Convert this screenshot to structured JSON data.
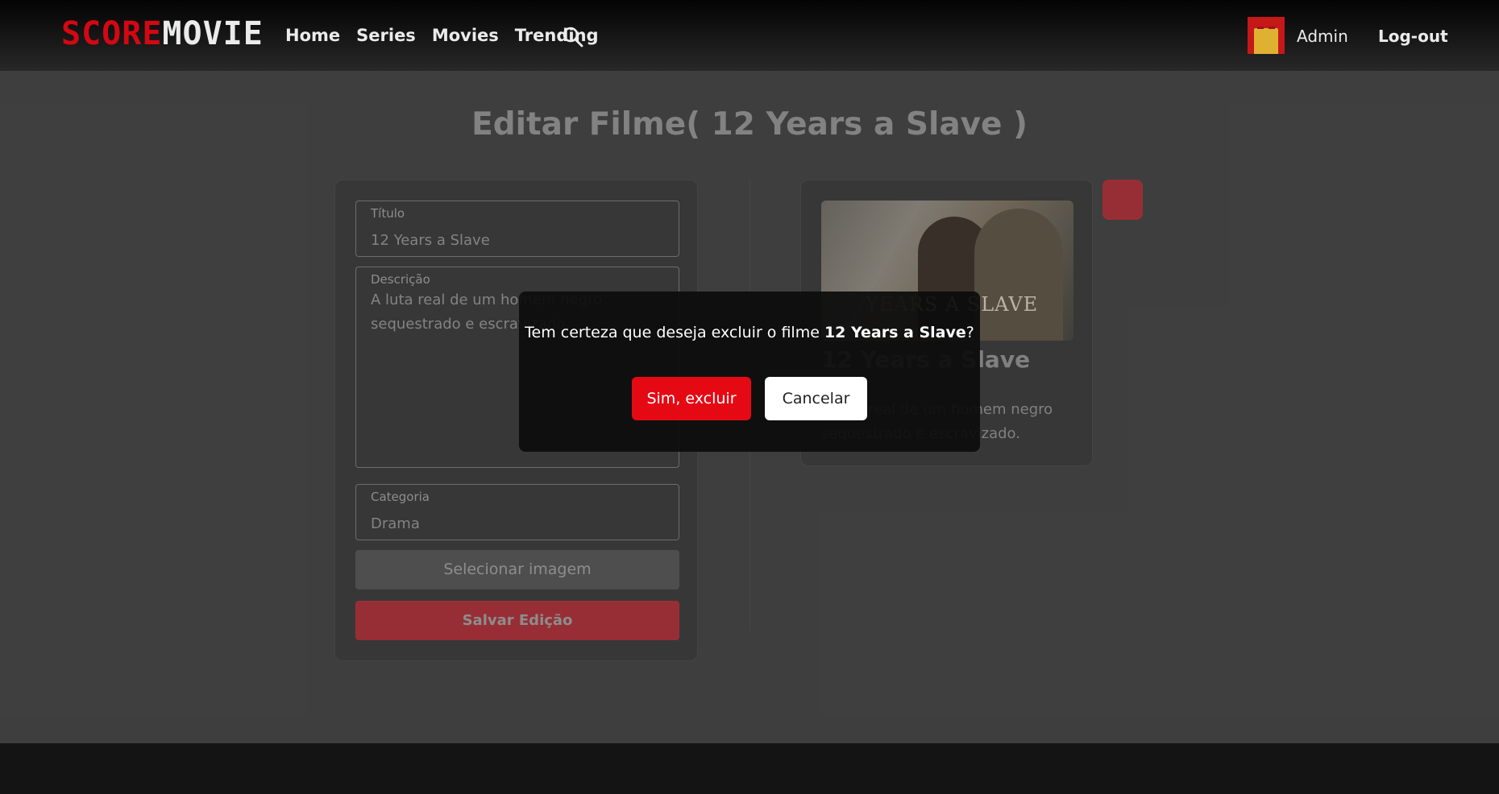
{
  "header": {
    "logo": {
      "part1": "SCORE",
      "part2": "MOVIE"
    },
    "nav": [
      {
        "label": "Home"
      },
      {
        "label": "Series"
      },
      {
        "label": "Movies"
      },
      {
        "label": "Trending"
      }
    ],
    "search_icon": "search-icon",
    "user": {
      "name": "Admin",
      "avatar_icon": "avatar"
    },
    "logout_label": "Log-out"
  },
  "page": {
    "title": "Editar Filme( 12 Years a Slave )"
  },
  "form": {
    "title_field": {
      "label": "Título",
      "value": "12 Years a Slave"
    },
    "description_field": {
      "label": "Descrição",
      "value": "A luta real de um homem negro sequestrado e escravizado."
    },
    "category_field": {
      "label": "Categoria",
      "value": "Drama"
    },
    "select_image_label": "Selecionar imagem",
    "save_label": "Salvar Edição"
  },
  "preview": {
    "poster_text": "YEARS A SLAVE",
    "title": "12 Years a Slave",
    "description": "A luta real de um homem negro sequestrado e escravizado."
  },
  "modal": {
    "message_prefix": "Tem certeza que deseja excluir o filme ",
    "movie_name": "12 Years a Slave",
    "message_suffix": "?",
    "confirm_label": "Sim, excluir",
    "cancel_label": "Cancelar"
  },
  "colors": {
    "brand_red": "#e50914",
    "save_red": "#a5323a",
    "background": "#444444"
  }
}
